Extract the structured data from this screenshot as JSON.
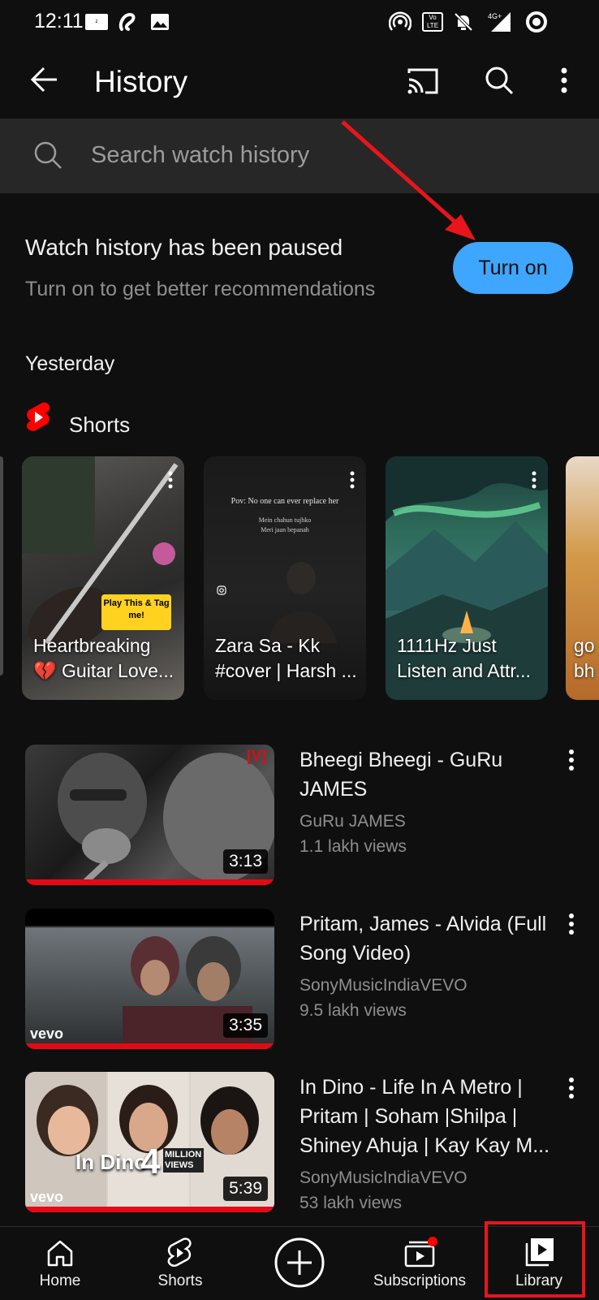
{
  "status_bar": {
    "time": "12:11"
  },
  "app_bar": {
    "title": "History"
  },
  "search": {
    "placeholder": "Search watch history"
  },
  "paused_notice": {
    "title": "Watch history has been paused",
    "subtitle": "Turn on to get better recommendations",
    "button_label": "Turn on"
  },
  "section_label": "Yesterday",
  "shorts_section": {
    "label": "Shorts",
    "items": [
      {
        "line1": "Heartbreaking",
        "line2": "💔 Guitar Love...",
        "sticker": "Play This & Tag me!"
      },
      {
        "line1": "Zara Sa - Kk",
        "line2": "#cover | Harsh ...",
        "overlay1": "Pov: No one can ever replace her",
        "overlay2": "Mein chahun tujhko",
        "overlay3": "Meri jaan bepanah"
      },
      {
        "line1": "1111Hz Just",
        "line2": "Listen and Attr..."
      },
      {
        "line1": "go",
        "line2": "bh"
      }
    ]
  },
  "videos": [
    {
      "title": "Bheegi Bheegi - GuRu JAMES",
      "channel": "GuRu JAMES",
      "views": "1.1 lakh views",
      "duration": "3:13",
      "watched": 1.0,
      "logo": "[V]"
    },
    {
      "title": "Pritam, James - Alvida (Full Song Video)",
      "channel": "SonyMusicIndiaVEVO",
      "views": "9.5 lakh views",
      "duration": "3:35",
      "watched": 1.0,
      "logo": "vevo"
    },
    {
      "title": "In Dino - Life In A Metro | Pritam | Soham |Shilpa | Shiney Ahuja | Kay Kay M...",
      "channel": "SonyMusicIndiaVEVO",
      "views": "53 lakh views",
      "duration": "5:39",
      "watched": 1.0,
      "logo": "vevo",
      "overlay_title": "In Dino",
      "overlay_number": "4",
      "overlay_badge": "MILLION VIEWS"
    }
  ],
  "bottom_nav": {
    "home": "Home",
    "shorts": "Shorts",
    "subscriptions": "Subscriptions",
    "library": "Library"
  },
  "colors": {
    "background": "#0f0f0f",
    "accent_blue": "#3ea6ff",
    "progress_red": "#e50914",
    "annotation_red": "#e8151b"
  }
}
